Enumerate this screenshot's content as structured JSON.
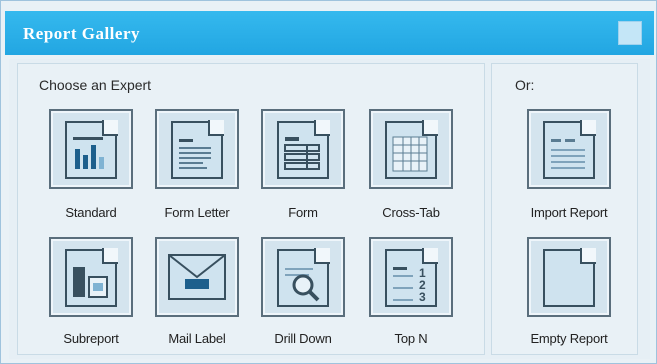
{
  "window": {
    "title": "Report Gallery"
  },
  "groups": {
    "experts_label": "Choose an Expert",
    "or_label": "Or:"
  },
  "experts": [
    {
      "label": "Standard",
      "icon": "standard-report-icon"
    },
    {
      "label": "Form Letter",
      "icon": "form-letter-icon"
    },
    {
      "label": "Form",
      "icon": "form-icon"
    },
    {
      "label": "Cross-Tab",
      "icon": "cross-tab-icon"
    },
    {
      "label": "Subreport",
      "icon": "subreport-icon"
    },
    {
      "label": "Mail Label",
      "icon": "mail-label-icon"
    },
    {
      "label": "Drill Down",
      "icon": "drill-down-icon"
    },
    {
      "label": "Top N",
      "icon": "top-n-icon"
    }
  ],
  "options": [
    {
      "label": "Import Report",
      "icon": "import-report-icon"
    },
    {
      "label": "Empty Report",
      "icon": "empty-report-icon"
    }
  ],
  "top_n_numbers": [
    "1",
    "2",
    "3"
  ],
  "colors": {
    "titlebar": "#2aaae6",
    "background": "#e9f1f6",
    "accent": "#38505f"
  }
}
